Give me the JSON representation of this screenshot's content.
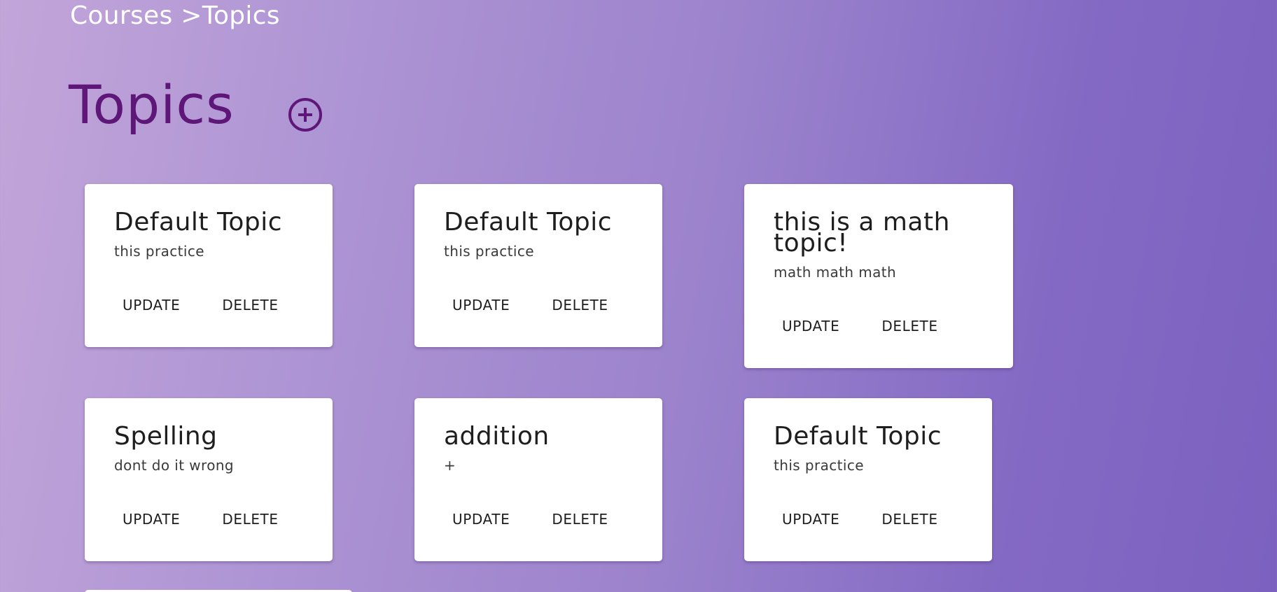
{
  "breadcrumb": {
    "courses": "Courses",
    "separator": " >",
    "topics": "Topics"
  },
  "page": {
    "title": "Topics",
    "add_icon": "circle-plus-icon"
  },
  "topics": [
    {
      "title": "Default Topic",
      "description": "this practice",
      "update_label": "UPDATE",
      "delete_label": "DELETE"
    },
    {
      "title": "Default Topic",
      "description": "this practice",
      "update_label": "UPDATE",
      "delete_label": "DELETE"
    },
    {
      "title": "this is a math topic!",
      "description": "math math math",
      "update_label": "UPDATE",
      "delete_label": "DELETE"
    },
    {
      "title": "Spelling",
      "description": "dont do it wrong",
      "update_label": "UPDATE",
      "delete_label": "DELETE"
    },
    {
      "title": "addition",
      "description": "+",
      "update_label": "UPDATE",
      "delete_label": "DELETE"
    },
    {
      "title": "Default Topic",
      "description": "this practice",
      "update_label": "UPDATE",
      "delete_label": "DELETE"
    }
  ],
  "colors": {
    "title": "#5e1678",
    "card_background": "#ffffff",
    "breadcrumb_text": "#ffffff"
  }
}
